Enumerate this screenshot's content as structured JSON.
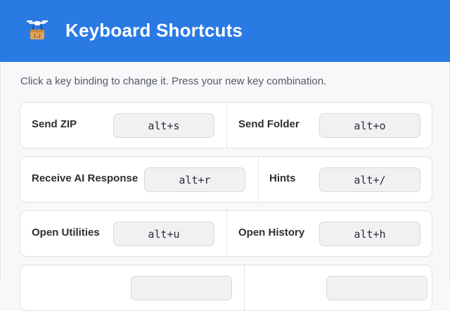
{
  "header": {
    "title": "Keyboard Shortcuts",
    "logo_icon": "drone-package-icon",
    "background_color": "#2a7ae4"
  },
  "instructions": "Click a key binding to change it. Press your new key combination.",
  "shortcuts": [
    [
      {
        "label": "Send ZIP",
        "key": "alt+s"
      },
      {
        "label": "Send Folder",
        "key": "alt+o"
      }
    ],
    [
      {
        "label": "Receive AI Response",
        "key": "alt+r"
      },
      {
        "label": "Hints",
        "key": "alt+/"
      }
    ],
    [
      {
        "label": "Open Utilities",
        "key": "alt+u"
      },
      {
        "label": "Open History",
        "key": "alt+h"
      }
    ],
    [
      {
        "label": "",
        "key": ""
      },
      {
        "label": "",
        "key": ""
      }
    ]
  ]
}
